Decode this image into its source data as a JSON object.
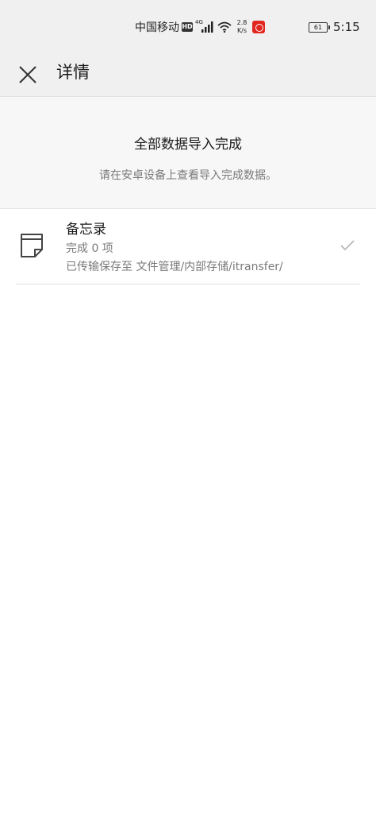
{
  "status_bar": {
    "carrier": "中国移动",
    "hd": "HD",
    "network": "4G",
    "speed_value": "2.8",
    "speed_unit": "K/s",
    "battery": "61",
    "time": "5:15"
  },
  "header": {
    "title": "详情",
    "close_icon": "close-icon"
  },
  "summary": {
    "title": "全部数据导入完成",
    "subtitle": "请在安卓设备上查看导入完成数据。"
  },
  "items": [
    {
      "icon": "memo-icon",
      "title": "备忘录",
      "count": "完成 0 项",
      "path": "已传输保存至 文件管理/内部存储/itransfer/",
      "status_icon": "check-icon"
    }
  ]
}
